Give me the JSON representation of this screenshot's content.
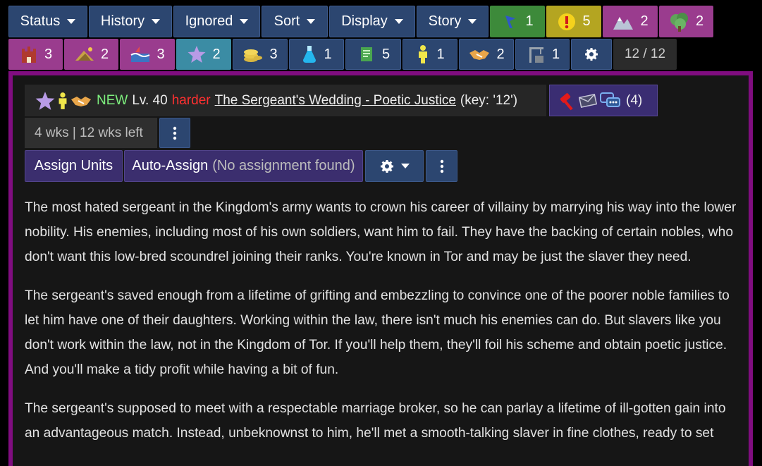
{
  "menu": [
    {
      "label": "Status"
    },
    {
      "label": "History"
    },
    {
      "label": "Ignored"
    },
    {
      "label": "Sort"
    },
    {
      "label": "Display"
    },
    {
      "label": "Story"
    }
  ],
  "filters_row1": [
    {
      "icon": "flag-icon",
      "count": "1",
      "color": "#3d8a3a"
    },
    {
      "icon": "exclamation-icon",
      "count": "5",
      "color": "#b4a521"
    },
    {
      "icon": "mountain-icon",
      "count": "2",
      "color": "#9a3c8e"
    },
    {
      "icon": "forest-icon",
      "count": "2",
      "color": "#9a3c8e"
    }
  ],
  "filters_row2": [
    {
      "icon": "castle-icon",
      "count": "3"
    },
    {
      "icon": "farm-icon",
      "count": "2"
    },
    {
      "icon": "sea-icon",
      "count": "3"
    },
    {
      "icon": "star-icon",
      "count": "2"
    },
    {
      "icon": "coins-icon",
      "count": "3"
    },
    {
      "icon": "potion-icon",
      "count": "1"
    },
    {
      "icon": "scroll-icon",
      "count": "5"
    },
    {
      "icon": "person-icon",
      "count": "1"
    },
    {
      "icon": "handshake-icon",
      "count": "2"
    },
    {
      "icon": "crane-icon",
      "count": "1"
    }
  ],
  "page_counter": "12 / 12",
  "quest": {
    "new_label": "NEW",
    "level": "Lv. 40",
    "difficulty": "harder",
    "name": "The Sergeant's Wedding - Poetic Justice",
    "key": "(key: '12')",
    "tag_count": "(4)",
    "time": "4 wks | 12 wks left",
    "assign_units": "Assign Units",
    "auto_assign": "Auto-Assign",
    "auto_assign_note": "(No assignment found)"
  },
  "story": [
    "The most hated sergeant in the Kingdom's army wants to crown his career of villainy by marrying his way into the lower nobility. His enemies, including most of his own soldiers, want him to fail. They have the backing of certain nobles, who don't want this low-bred scoundrel joining their ranks. You're known in Tor and may be just the slaver they need.",
    "The sergeant's saved enough from a lifetime of grifting and embezzling to convince one of the poorer noble families to let him have one of their daughters. Working within the law, there isn't much his enemies can do. But slavers like you don't work within the law, not in the Kingdom of Tor. If you'll help them, they'll foil his scheme and obtain poetic justice. And you'll make a tidy profit while having a bit of fun.",
    "The sergeant's supposed to meet with a respectable marriage broker, so he can parlay a lifetime of ill-gotten gain into an advantageous match. Instead, unbeknownst to him, he'll met a smooth-talking slaver in fine clothes, ready to set"
  ]
}
